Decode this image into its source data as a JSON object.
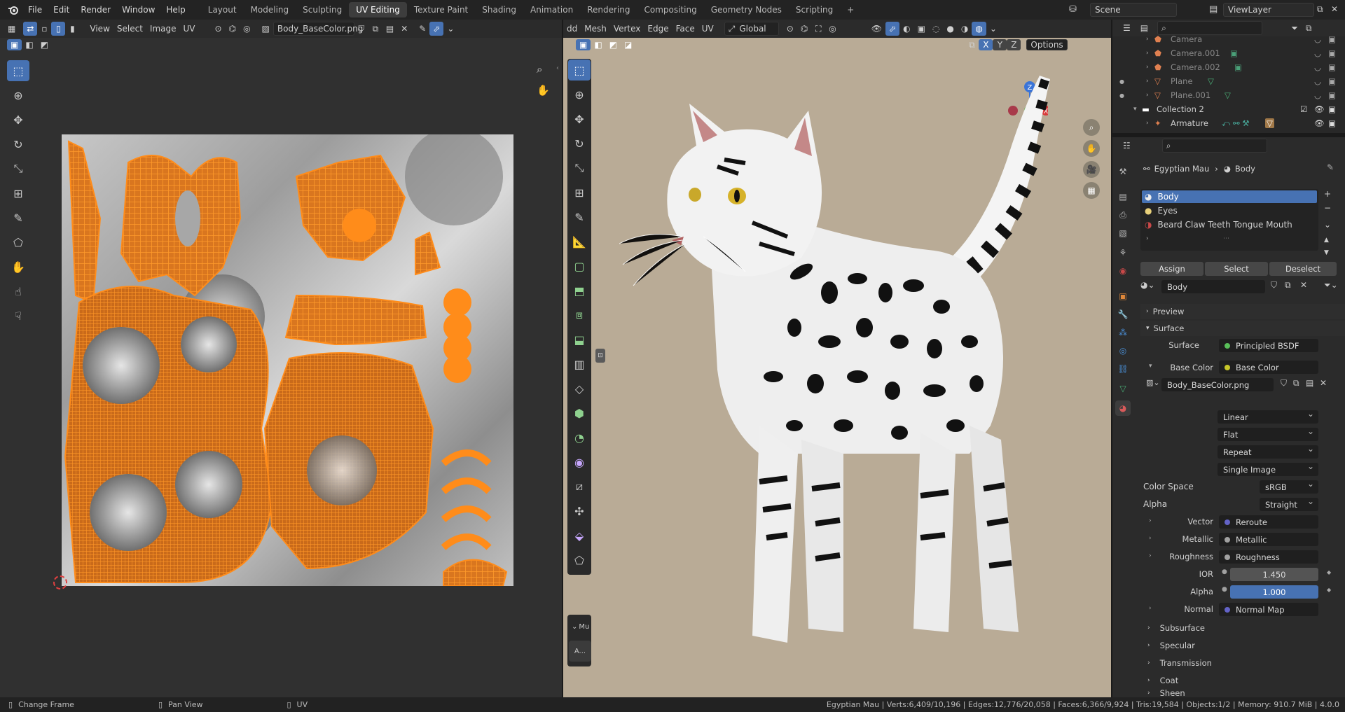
{
  "topbar": {
    "menus": [
      "File",
      "Edit",
      "Render",
      "Window",
      "Help"
    ],
    "workspaces": [
      "Layout",
      "Modeling",
      "Sculpting",
      "UV Editing",
      "Texture Paint",
      "Shading",
      "Animation",
      "Rendering",
      "Compositing",
      "Geometry Nodes",
      "Scripting"
    ],
    "active_workspace": "UV Editing",
    "add_tab": "+",
    "scene": "Scene",
    "view_layer": "ViewLayer"
  },
  "uv_header": {
    "menus": [
      "View",
      "Select",
      "Image",
      "UV"
    ],
    "image_name": "Body_BaseColor.png"
  },
  "viewport_header": {
    "menus": [
      "dd",
      "Mesh",
      "Vertex",
      "Edge",
      "Face",
      "UV"
    ],
    "orientation": "Global",
    "axes": [
      "X",
      "Y",
      "Z"
    ],
    "options": "Options"
  },
  "viewport_side_tab": {
    "label": "Mu",
    "button": "A..."
  },
  "gizmo": {
    "z": "Z",
    "y": "Y",
    "x": "X"
  },
  "outliner": {
    "rows": [
      {
        "name": "Camera"
      },
      {
        "name": "Camera.001"
      },
      {
        "name": "Camera.002"
      },
      {
        "name": "Plane"
      },
      {
        "name": "Plane.001"
      },
      {
        "name": "Collection 2"
      },
      {
        "name": "Armature"
      }
    ]
  },
  "properties": {
    "breadcrumb_object": "Egyptian Mau",
    "breadcrumb_material": "Body",
    "slots": [
      "Body",
      "Eyes",
      "Beard Claw Teeth Tongue Mouth"
    ],
    "assign": "Assign",
    "select": "Select",
    "deselect": "Deselect",
    "material_name": "Body",
    "preview": "Preview",
    "surface_panel": "Surface",
    "surface_label": "Surface",
    "surface_value": "Principled BSDF",
    "base_color_label": "Base Color",
    "base_color_value": "Base Color",
    "image_name": "Body_BaseColor.png",
    "interpolation": "Linear",
    "projection": "Flat",
    "extension": "Repeat",
    "source": "Single Image",
    "color_space_label": "Color Space",
    "color_space": "sRGB",
    "alpha_label": "Alpha",
    "alpha_mode": "Straight",
    "inputs": [
      {
        "label": "Vector",
        "value": "Reroute"
      },
      {
        "label": "Metallic",
        "value": "Metallic"
      },
      {
        "label": "Roughness",
        "value": "Roughness"
      }
    ],
    "ior_label": "IOR",
    "ior": "1.450",
    "alpha2_label": "Alpha",
    "alpha_value": "1.000",
    "alpha_fraction": 1.0,
    "normal_label": "Normal",
    "normal_value": "Normal Map",
    "subpanels": [
      "Subsurface",
      "Specular",
      "Transmission",
      "Coat",
      "Sheen"
    ]
  },
  "statusbar": {
    "left": [
      "Change Frame",
      "Pan View",
      "UV"
    ],
    "stats": "Egyptian Mau | Verts:6,409/10,196 | Edges:12,776/20,058 | Faces:6,366/9,924 | Tris:19,584 | Objects:1/2 | Memory: 910.7 MiB | 4.0.0"
  },
  "colors": {
    "accent": "#4772b3",
    "uv_orange": "#ff8c1a",
    "viewport_bg": "#b9ab96"
  }
}
